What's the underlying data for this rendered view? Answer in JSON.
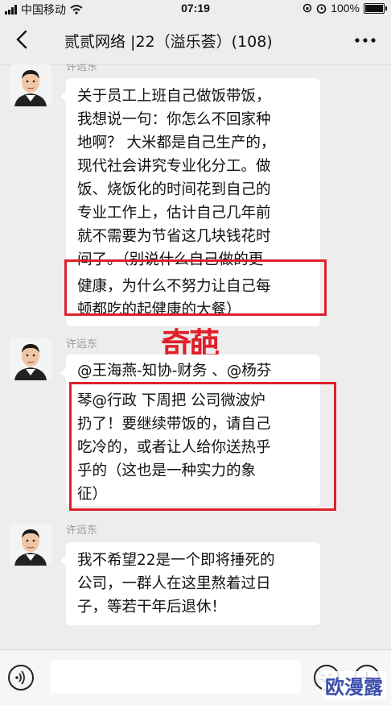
{
  "status_bar": {
    "carrier": "中国移动",
    "time": "07:19",
    "battery": "100%"
  },
  "header": {
    "title": "贰贰网络 |22（溢乐荟）(108)"
  },
  "messages": [
    {
      "sender": "许远东",
      "lines": [
        "关于员工上班自己做饭带饭，",
        "我想说一句：你怎么不回家种",
        "地啊？ 大米都是自己生产的，",
        "现代社会讲究专业化分工。做",
        "饭、烧饭化的时间花到自己的",
        "专业工作上，估计自己几年前",
        "就不需要为节省这几块钱花时",
        "间了。（别说什么自己做的更",
        "健康，为什么不努力让自己每",
        "顿都吃的起健康的大餐）"
      ]
    },
    {
      "sender": "许远东",
      "lines": [
        "@王海燕-知协-财务 、@杨芬",
        "琴@行政  下周把 公司微波炉",
        "扔了！要继续带饭的，请自己",
        "吃冷的，或者让人给你送热乎",
        "乎的（这也是一种实力的象",
        "征）"
      ]
    },
    {
      "sender": "许远东",
      "lines": [
        "我不希望22是一个即将捶死的",
        "公司，一群人在这里熬着过日",
        "子，等若干年后退休！"
      ]
    }
  ],
  "annotation": {
    "stamp_text": "奇葩",
    "highlight_color": "#e0202a"
  },
  "watermark": "欧漫露",
  "icons": [
    "back-arrow-icon",
    "more-icon",
    "voice-icon",
    "emoji-icon",
    "plus-icon",
    "wifi-icon",
    "alarm-icon",
    "battery-icon"
  ]
}
